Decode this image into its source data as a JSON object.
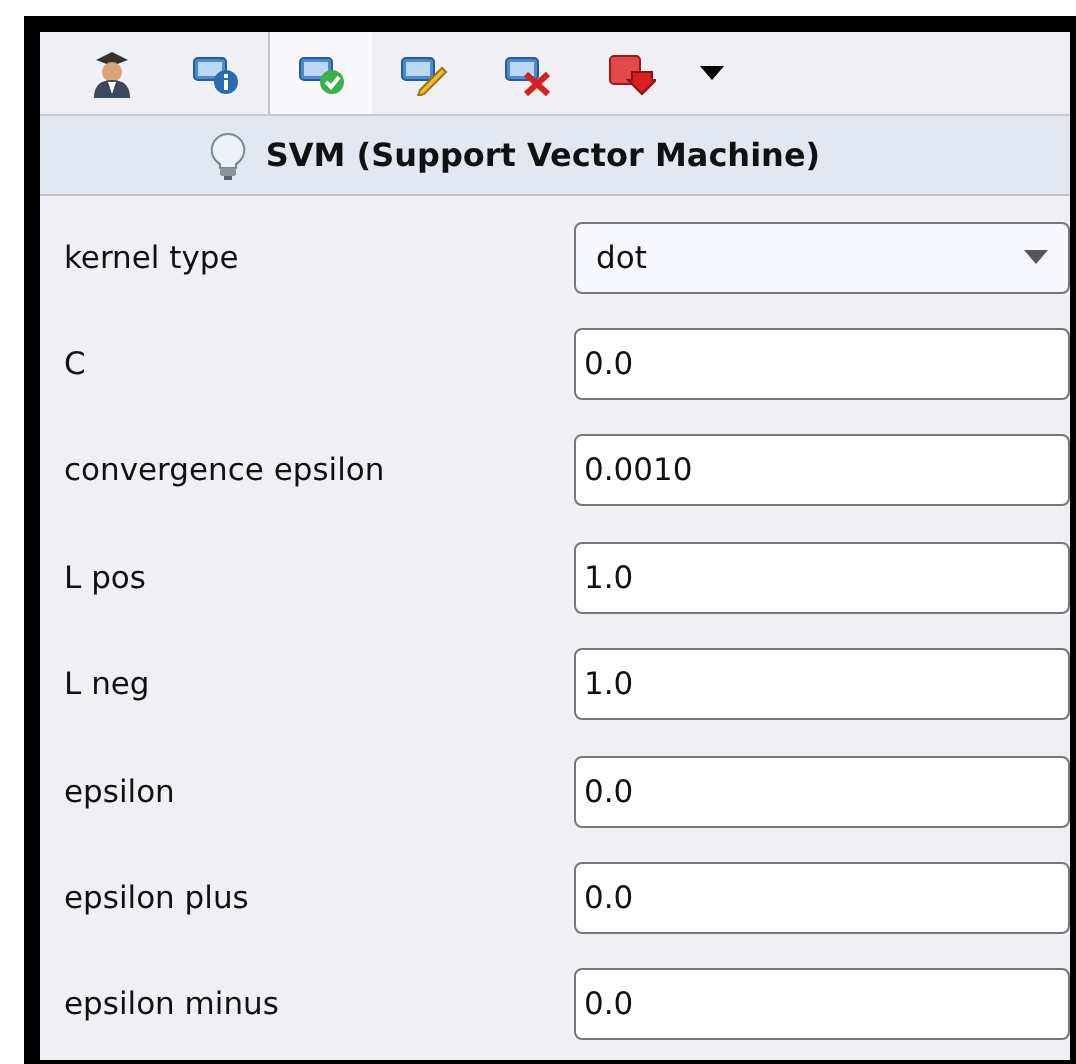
{
  "toolbar": {
    "buttons": [
      {
        "kind": "expert",
        "selected": false
      },
      {
        "kind": "info",
        "selected": false
      },
      {
        "kind": "check",
        "selected": true
      },
      {
        "kind": "edit",
        "selected": false
      },
      {
        "kind": "delete",
        "selected": false
      },
      {
        "kind": "export",
        "selected": false
      },
      {
        "kind": "menu",
        "selected": false
      }
    ]
  },
  "title": "SVM (Support Vector Machine)",
  "parameters": [
    {
      "label": "kernel type",
      "kind": "dropdown",
      "value": "dot"
    },
    {
      "label": "C",
      "kind": "text",
      "value": "0.0"
    },
    {
      "label": "convergence epsilon",
      "kind": "text",
      "value": "0.0010"
    },
    {
      "label": "L pos",
      "kind": "text",
      "value": "1.0"
    },
    {
      "label": "L neg",
      "kind": "text",
      "value": "1.0"
    },
    {
      "label": "epsilon",
      "kind": "text",
      "value": "0.0"
    },
    {
      "label": "epsilon plus",
      "kind": "text",
      "value": "0.0"
    },
    {
      "label": "epsilon minus",
      "kind": "text",
      "value": "0.0"
    }
  ]
}
